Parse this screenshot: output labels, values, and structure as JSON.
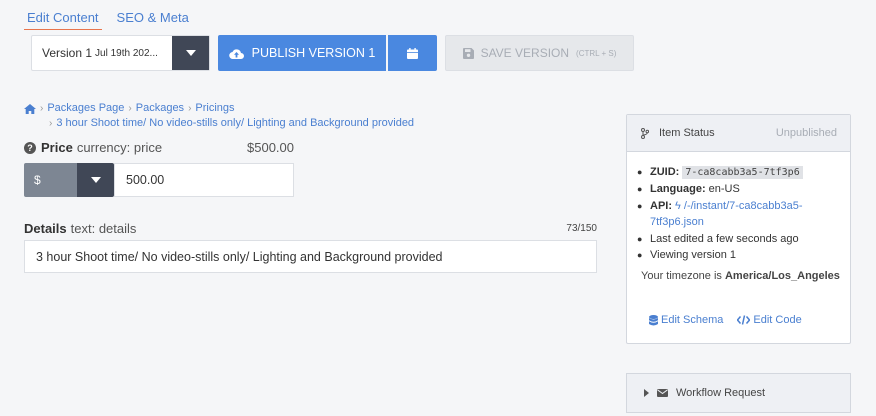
{
  "tabs": [
    {
      "label": "Edit Content",
      "active": true
    },
    {
      "label": "SEO & Meta",
      "active": false
    }
  ],
  "toolbar": {
    "version_label": "Version 1",
    "version_date": "Jul 19th 202...",
    "publish_label": "PUBLISH VERSION 1",
    "save_label": "SAVE VERSION",
    "save_hint": "(CTRL + S)"
  },
  "breadcrumb": {
    "items": [
      "Packages Page",
      "Packages",
      "Pricings"
    ],
    "current": "3 hour Shoot time/ No video-stills only/ Lighting and Background provided"
  },
  "price_field": {
    "label": "Price",
    "meta": "currency: price",
    "display_value": "$500.00",
    "currency_symbol": "$",
    "value": "500.00"
  },
  "details_field": {
    "label": "Details",
    "meta": "text: details",
    "char_count": "73/150",
    "value": "3 hour Shoot time/ No video-stills only/ Lighting and Background provided"
  },
  "item_status": {
    "title": "Item Status",
    "state": "Unpublished",
    "zuid_label": "ZUID:",
    "zuid": "7-ca8cabb3a5-7tf3p6",
    "language_label": "Language:",
    "language": "en-US",
    "api_label": "API:",
    "api_link": "/-/instant/7-ca8cabb3a5-7tf3p6.json",
    "last_edited": "Last edited a few seconds ago",
    "viewing": "Viewing version 1",
    "timezone_prefix": "Your timezone is",
    "timezone": "America/Los_Angeles",
    "edit_schema": "Edit Schema",
    "edit_code": "Edit Code"
  },
  "workflow": {
    "label": "Workflow Request"
  },
  "colors": {
    "accent": "#4a88e0",
    "link": "#4a7fd0",
    "dark": "#404756",
    "tab_underline": "#e8744c"
  }
}
